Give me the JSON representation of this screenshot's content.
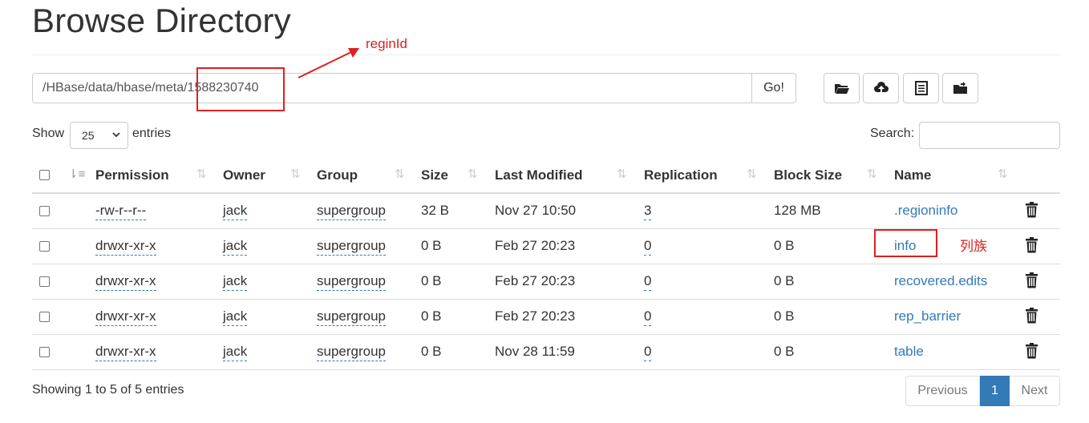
{
  "page": {
    "title": "Browse Directory"
  },
  "path_bar": {
    "value": "/HBase/data/hbase/meta/1588230740",
    "go_label": "Go!"
  },
  "toolbar": {
    "buttons": [
      {
        "icon": "folder-open-icon"
      },
      {
        "icon": "cloud-upload-icon"
      },
      {
        "icon": "list-alt-icon"
      },
      {
        "icon": "folder-move-icon"
      }
    ]
  },
  "length_control": {
    "show_label": "Show",
    "selected": "25",
    "entries_label": "entries"
  },
  "search": {
    "label": "Search:",
    "value": ""
  },
  "table": {
    "columns": [
      "Permission",
      "Owner",
      "Group",
      "Size",
      "Last Modified",
      "Replication",
      "Block Size",
      "Name"
    ],
    "rows": [
      {
        "permission": "-rw-r--r--",
        "owner": "jack",
        "group": "supergroup",
        "size": "32 B",
        "modified": "Nov 27 10:50",
        "replication": "3",
        "block_size": "128 MB",
        "name": ".regioninfo"
      },
      {
        "permission": "drwxr-xr-x",
        "owner": "jack",
        "group": "supergroup",
        "size": "0 B",
        "modified": "Feb 27 20:23",
        "replication": "0",
        "block_size": "0 B",
        "name": "info"
      },
      {
        "permission": "drwxr-xr-x",
        "owner": "jack",
        "group": "supergroup",
        "size": "0 B",
        "modified": "Feb 27 20:23",
        "replication": "0",
        "block_size": "0 B",
        "name": "recovered.edits"
      },
      {
        "permission": "drwxr-xr-x",
        "owner": "jack",
        "group": "supergroup",
        "size": "0 B",
        "modified": "Feb 27 20:23",
        "replication": "0",
        "block_size": "0 B",
        "name": "rep_barrier"
      },
      {
        "permission": "drwxr-xr-x",
        "owner": "jack",
        "group": "supergroup",
        "size": "0 B",
        "modified": "Nov 28 11:59",
        "replication": "0",
        "block_size": "0 B",
        "name": "table"
      }
    ]
  },
  "footer": {
    "info": "Showing 1 to 5 of 5 entries",
    "pagination": {
      "previous": "Previous",
      "current": "1",
      "next": "Next"
    }
  },
  "annotations": {
    "region_id_label": "reginId",
    "column_family_label": "列族",
    "color": "#e02020"
  },
  "colors": {
    "link": "#337ab7",
    "active_page": "#337ab7"
  }
}
